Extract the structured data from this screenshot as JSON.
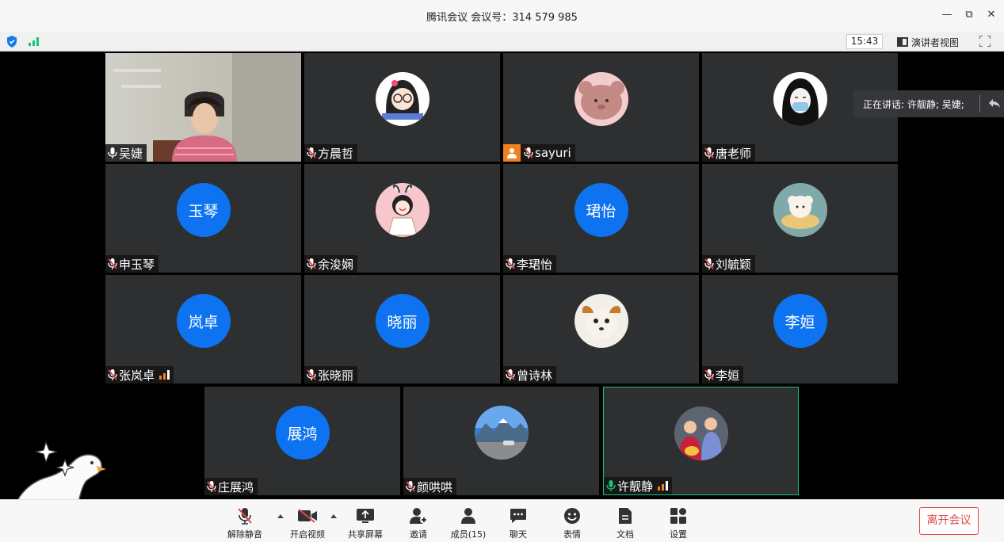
{
  "window": {
    "title": "腾讯会议 会议号：314 579 985",
    "minimize_glyph": "—",
    "restore_glyph": "⧉",
    "close_glyph": "✕"
  },
  "infobar": {
    "time": "15:43",
    "presenter_view_label": "演讲者视图"
  },
  "speaking": {
    "text": "正在讲话: 许靓静; 吴婕;"
  },
  "participants": [
    {
      "name": "吴婕",
      "kind": "camera",
      "mic": "on"
    },
    {
      "name": "方晨哲",
      "kind": "image",
      "avatar": "girl-glasses",
      "mic": "muted"
    },
    {
      "name": "sayuri",
      "kind": "image",
      "avatar": "pink-bear",
      "mic": "muted",
      "host": true
    },
    {
      "name": "唐老师",
      "kind": "image",
      "avatar": "masked-girl",
      "mic": "muted"
    },
    {
      "name": "申玉琴",
      "kind": "text",
      "avatar_text": "玉琴",
      "mic": "muted"
    },
    {
      "name": "余浚娴",
      "kind": "image",
      "avatar": "cartoon-bunny-girl",
      "mic": "muted"
    },
    {
      "name": "李珺怡",
      "kind": "text",
      "avatar_text": "珺怡",
      "mic": "muted"
    },
    {
      "name": "刘毓颖",
      "kind": "image",
      "avatar": "dog-bowl",
      "mic": "muted"
    },
    {
      "name": "张岚卓",
      "kind": "text",
      "avatar_text": "岚卓",
      "mic": "muted",
      "signal": true
    },
    {
      "name": "张晓丽",
      "kind": "text",
      "avatar_text": "晓丽",
      "mic": "muted"
    },
    {
      "name": "曾诗林",
      "kind": "image",
      "avatar": "puppy",
      "mic": "muted"
    },
    {
      "name": "李姮",
      "kind": "text",
      "avatar_text": "李姮",
      "mic": "muted"
    },
    {
      "name": "庄展鸿",
      "kind": "text",
      "avatar_text": "展鸿",
      "mic": "muted"
    },
    {
      "name": "颜哄哄",
      "kind": "image",
      "avatar": "mountain-road",
      "mic": "muted"
    },
    {
      "name": "许靓静",
      "kind": "image",
      "avatar": "family-photo",
      "mic": "speaking",
      "signal": true,
      "active": true
    }
  ],
  "toolbar": {
    "unmute": "解除静音",
    "video": "开启视频",
    "share": "共享屏幕",
    "invite": "邀请",
    "members": "成员(15)",
    "chat": "聊天",
    "reactions": "表情",
    "docs": "文档",
    "settings": "设置",
    "leave": "离开会议"
  },
  "colors": {
    "avatar_blue": "#0d73f0",
    "tile_bg": "#2e2f31",
    "speaking_green": "#17c27a",
    "leave_red": "#e0494b",
    "signal_orange": "#f0821e"
  }
}
